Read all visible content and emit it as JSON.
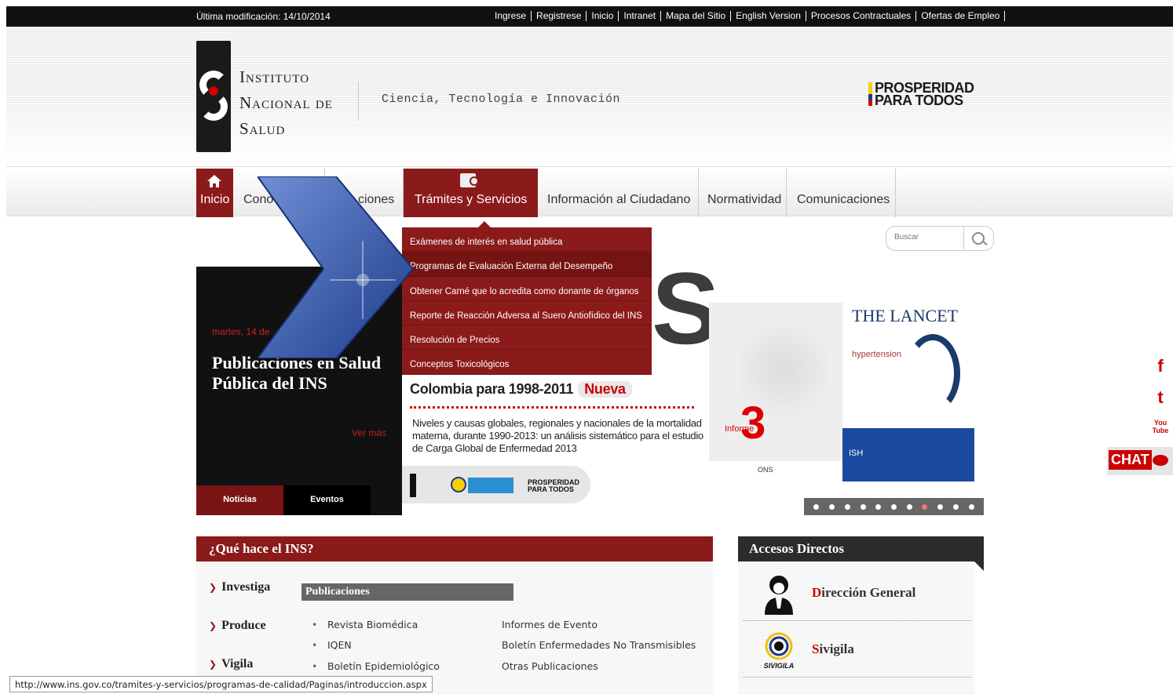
{
  "topbar": {
    "last_modified": "Última modificación: 14/10/2014",
    "links": [
      "Ingrese",
      "Registrese",
      "Inicio",
      "Intranet",
      "Mapa del Sitio",
      "English Version",
      "Procesos Contractuales",
      "Ofertas de Empleo"
    ]
  },
  "header": {
    "logo_lines": [
      "Instituto",
      "Nacional de",
      "Salud"
    ],
    "tagline": "Ciencia, Tecnología e Innovación",
    "prosperidad": [
      "PROSPERIDAD",
      "PARA TODOS"
    ]
  },
  "nav": {
    "items": [
      {
        "label": "Inicio"
      },
      {
        "label": "Cono"
      },
      {
        "label": "ciones"
      },
      {
        "label": "Trámites y Servicios"
      },
      {
        "label": "Información al Ciudadano"
      },
      {
        "label": "Normatividad"
      },
      {
        "label": "Comunicaciones"
      }
    ]
  },
  "dropdown": {
    "items": [
      "Exámenes de interés en salud pública",
      "Programas de Evaluación Externa del Desempeño",
      "Obtener Carné que lo acredita como donante de órganos",
      "Reporte de Reacción Adversa al Suero Antiofídico del INS",
      "Resolución de Precios",
      "Conceptos Toxicológicos"
    ],
    "active_index": 1
  },
  "search": {
    "placeholder": "Buscar"
  },
  "news": {
    "date": "martes, 14 de",
    "headline": "Publicaciones en Salud Pública del INS",
    "more": "Ver más",
    "tabs": [
      "Noticias",
      "Eventos"
    ]
  },
  "banner": {
    "big_letter": "S",
    "title": "Colombia para 1998-2011",
    "badge": "Nueva",
    "description": "Niveles y causas globales, regionales y nacionales de la mortalidad materna, durante 1990-2013: un análisis sistemático para el estudio de Carga Global de Enfermedad 2013",
    "logo_prosperidad": [
      "PROSPERIDAD",
      "PARA TODOS"
    ]
  },
  "publications_image": {
    "informe_label": "Informe",
    "informe_number": "3",
    "lancet_title": "THE LANCET",
    "lancet_subtitle": "hypertension",
    "ish": "ISH",
    "partner": "ONS"
  },
  "carousel": {
    "count": 11,
    "active_index": 7
  },
  "que_hace": {
    "title": "¿Qué hace el INS?",
    "side": [
      "Investiga",
      "Produce",
      "Vigila"
    ],
    "publicaciones_title": "Publicaciones",
    "col1": [
      "Revista Biomédica",
      "IQEN",
      "Boletín Epidemiológico"
    ],
    "col2": [
      "Informes de Evento",
      "Boletín Enfermedades No Transmisibles",
      "Otras Publicaciones"
    ]
  },
  "accesos": {
    "title": "Accesos Directos",
    "items": [
      {
        "first": "D",
        "rest": "irección General",
        "icon": "director-icon"
      },
      {
        "first": "S",
        "rest": "ivigila",
        "icon": "sivigila-icon",
        "icon_text": "SIVIGILA"
      }
    ]
  },
  "social": {
    "facebook": "f",
    "twitter": "t",
    "youtube": "You Tube",
    "chat": "CHAT"
  },
  "status_url": "http://www.ins.gov.co/tramites-y-servicios/programas-de-calidad/Paginas/introduccion.aspx",
  "colors": {
    "brand_red": "#8b1a1a",
    "dark": "#111111",
    "arrow_blue": "#3b5fb0"
  }
}
